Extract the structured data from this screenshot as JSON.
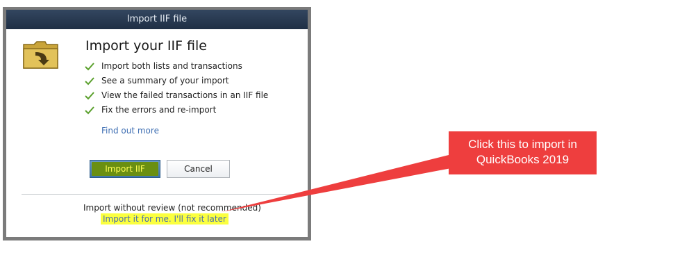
{
  "dialog": {
    "title": "Import IIF file",
    "heading": "Import your IIF file",
    "features": [
      "Import both lists and transactions",
      "See a summary of your import",
      "View the failed transactions in an IIF file",
      "Fix the errors and re-import"
    ],
    "find_more": "Find out more",
    "import_button": "Import IIF",
    "cancel_button": "Cancel",
    "no_review_label": "Import without review (not recommended)",
    "import_later_link": "Import it for me. I'll fix it later"
  },
  "callout": {
    "text_line1": "Click this to import in",
    "text_line2": "QuickBooks 2019"
  },
  "colors": {
    "titlebar": "#2a3c55",
    "import_button_fill": "#6a8f12",
    "import_button_text": "#ffff55",
    "link": "#3f6fb3",
    "highlight": "#fbff3f",
    "callout": "#ee3e3e",
    "check": "#5aa02c"
  },
  "icons": {
    "folder": "folder-import-icon",
    "check": "check-icon"
  }
}
